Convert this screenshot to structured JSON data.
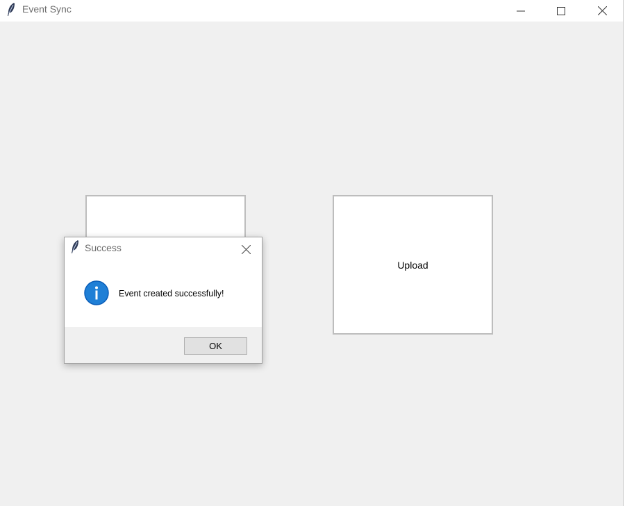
{
  "window": {
    "title": "Event Sync",
    "icon": "feather-icon"
  },
  "main": {
    "left_button_label": "",
    "upload_button_label": "Upload"
  },
  "dialog": {
    "title": "Success",
    "icon": "info-icon",
    "message": "Event created successfully!",
    "ok_label": "OK"
  },
  "colors": {
    "window_bg": "#f0f0f0",
    "info_blue": "#0a6fd1"
  }
}
